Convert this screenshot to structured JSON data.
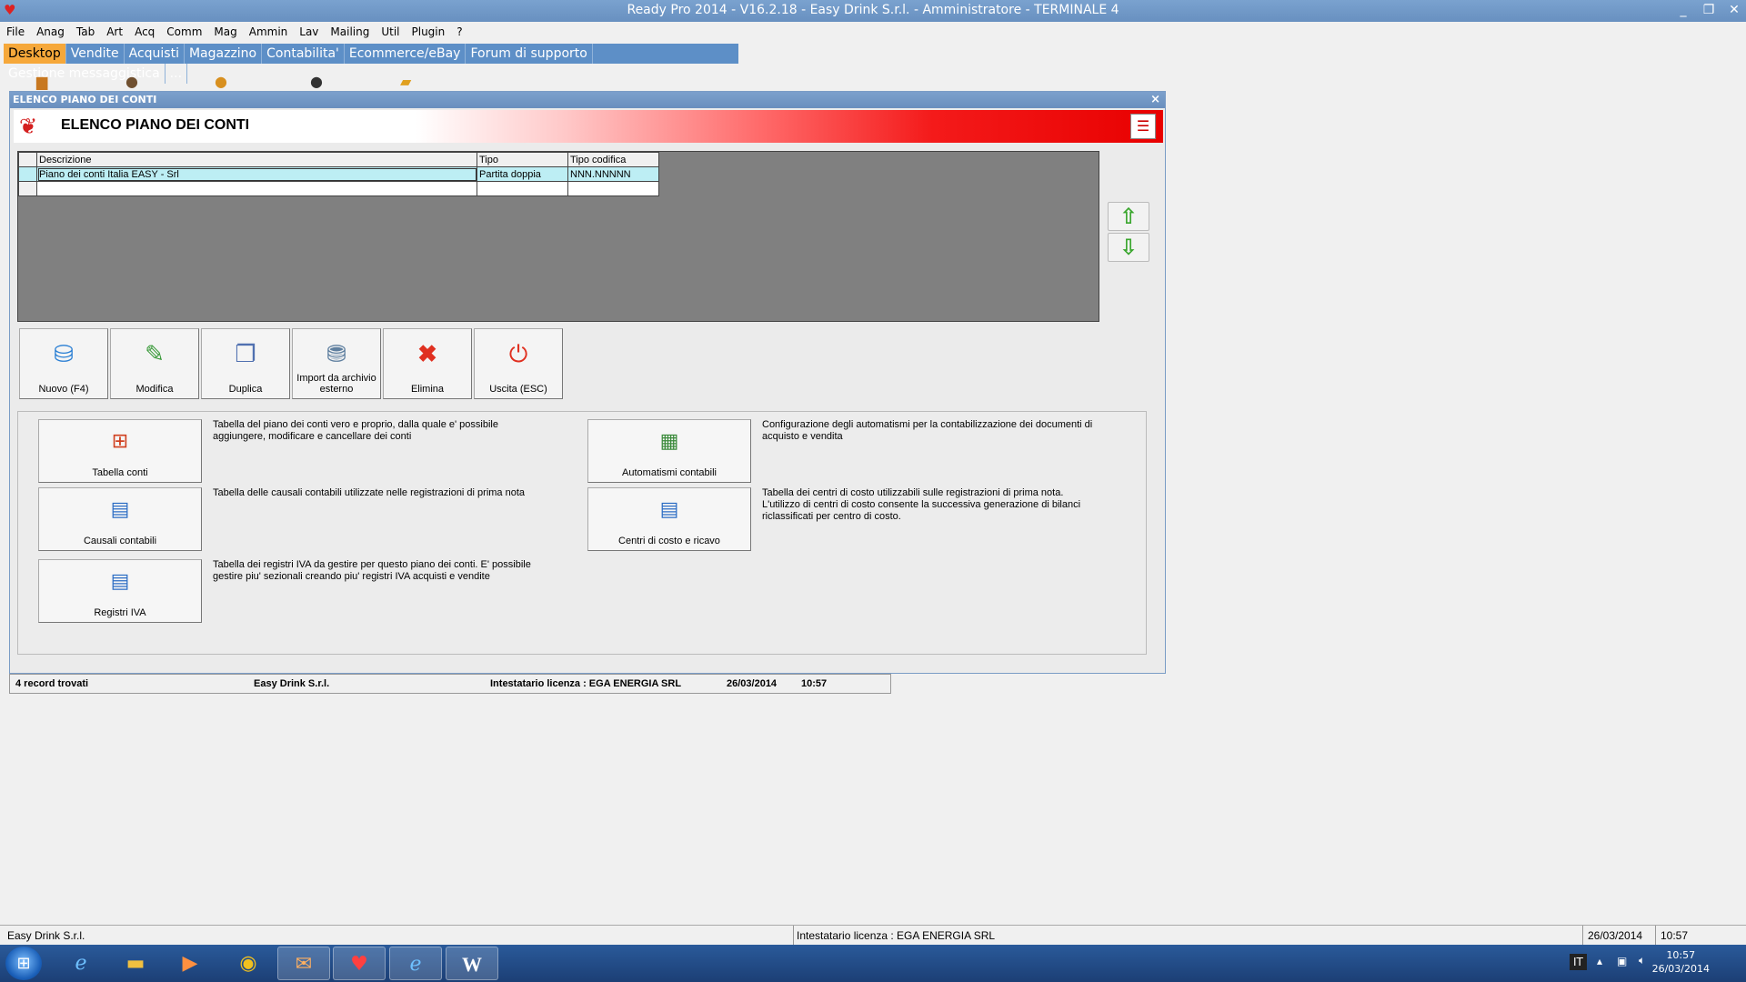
{
  "window": {
    "title": "Ready Pro 2014 - V16.2.18 - Easy Drink S.r.l. - Amministratore - TERMINALE 4",
    "minimize": "_",
    "restore": "❐",
    "close": "✕"
  },
  "menu": [
    "File",
    "Anag",
    "Tab",
    "Art",
    "Acq",
    "Comm",
    "Mag",
    "Ammin",
    "Lav",
    "Mailing",
    "Util",
    "Plugin",
    "?"
  ],
  "tabs": [
    "Desktop",
    "Vendite",
    "Acquisti",
    "Magazzino",
    "Contabilita'",
    "Ecommerce/eBay",
    "Forum di supporto",
    "Gestione messaggistica",
    "..."
  ],
  "child": {
    "caption": "ELENCO PIANO DEI CONTI",
    "close": "×",
    "banner_title": "ELENCO PIANO DEI CONTI",
    "grid": {
      "headers": [
        "Descrizione",
        "Tipo",
        "Tipo codifica"
      ],
      "rows": [
        [
          "Piano dei conti Italia EASY - Srl",
          "Partita doppia",
          "NNN.NNNNN"
        ],
        [
          "",
          "",
          ""
        ]
      ]
    },
    "toolbar": {
      "new": "Nuovo (F4)",
      "edit": "Modifica",
      "duplicate": "Duplica",
      "import": "Import da archivio esterno",
      "delete": "Elimina",
      "exit": "Uscita (ESC)"
    },
    "panel": {
      "tabella_conti": {
        "label": "Tabella conti",
        "desc": "Tabella del piano dei conti vero e proprio, dalla quale e' possibile aggiungere, modificare e cancellare dei conti"
      },
      "causali": {
        "label": "Causali contabili",
        "desc": "Tabella delle causali contabili utilizzate nelle registrazioni di prima nota"
      },
      "registri": {
        "label": "Registri IVA",
        "desc": "Tabella dei registri IVA da gestire per questo piano dei conti. E' possibile gestire piu' sezionali creando piu' registri IVA acquisti e vendite"
      },
      "automatismi": {
        "label": "Automatismi contabili",
        "desc": "Configurazione degli automatismi per la contabilizzazione dei documenti di acquisto e vendita"
      },
      "centri": {
        "label": "Centri di costo e ricavo",
        "desc": "Tabella dei centri di costo utilizzabili sulle registrazioni di prima nota. L'utilizzo di centri di costo consente la successiva generazione di bilanci riclassificati per centro di costo."
      }
    },
    "status": {
      "records": "4 record trovati",
      "company": "Easy Drink S.r.l.",
      "license": "Intestatario licenza : EGA ENERGIA SRL",
      "date": "26/03/2014",
      "time": "10:57"
    }
  },
  "main_status": {
    "company": "Easy Drink S.r.l.",
    "license": "Intestatario licenza : EGA ENERGIA SRL",
    "date": "26/03/2014",
    "time": "10:57"
  },
  "taskbar": {
    "lang": "IT",
    "clock_time": "10:57",
    "clock_date": "26/03/2014"
  }
}
